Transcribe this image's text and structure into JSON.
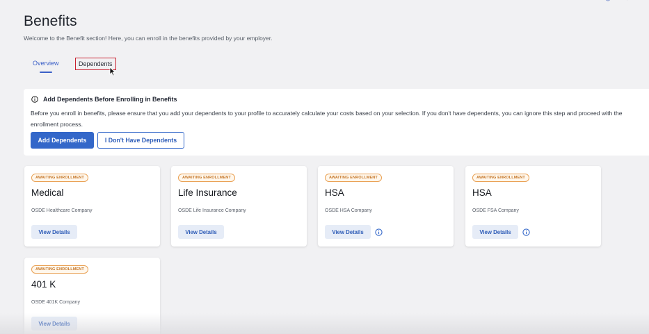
{
  "header": {
    "title": "Benefits",
    "subtitle": "Welcome to the Benefit section! Here, you can enroll in the benefits provided by your employer."
  },
  "tabs": [
    {
      "label": "Overview",
      "active": true
    },
    {
      "label": "Dependents",
      "active": false,
      "highlighted": true
    }
  ],
  "notice": {
    "icon": "info-circle-icon",
    "title": "Add Dependents Before Enrolling in Benefits",
    "text": "Before you enroll in benefits, please ensure that you add your dependents to your profile to accurately calculate your costs based on your selection. If you don't have dependents, you can ignore this step and proceed with the enrollment process.",
    "primary_button": "Add Dependents",
    "secondary_button": "I Don't Have Dependents"
  },
  "cards": [
    {
      "badge": "AWAITING ENROLLMENT",
      "title": "Medical",
      "company": "OSDE Healthcare Company",
      "button": "View Details",
      "info_icon": false
    },
    {
      "badge": "AWAITING ENROLLMENT",
      "title": "Life Insurance",
      "company": "OSDE Life Insurance Company",
      "button": "View Details",
      "info_icon": false
    },
    {
      "badge": "AWAITING ENROLLMENT",
      "title": "HSA",
      "company": "OSDE HSA Company",
      "button": "View Details",
      "info_icon": true
    },
    {
      "badge": "AWAITING ENROLLMENT",
      "title": "HSA",
      "company": "OSDE FSA Company",
      "button": "View Details",
      "info_icon": true
    },
    {
      "badge": "AWAITING ENROLLMENT",
      "title": "401 K",
      "company": "OSDE 401K Company",
      "button": "View Details",
      "info_icon": false
    }
  ],
  "colors": {
    "accent": "#3367c9",
    "badge": "#e9a052",
    "highlight_box": "#c9202f",
    "background": "#f1f1f3"
  }
}
